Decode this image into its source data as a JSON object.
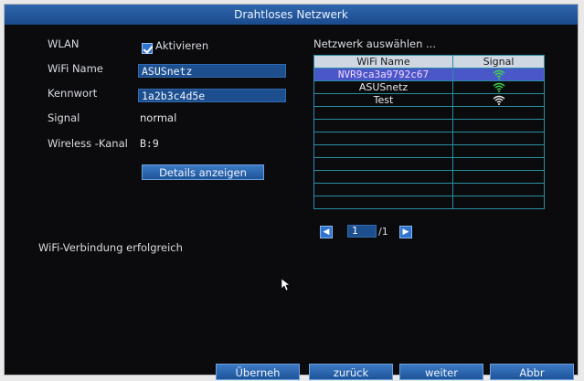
{
  "dialog": {
    "title": "Drahtloses Netzwerk"
  },
  "form": {
    "wlan_label": "WLAN",
    "wlan_checkbox_label": "Aktivieren",
    "wlan_checked": true,
    "wifi_name_label": "WiFi Name",
    "wifi_name_value": "ASUSnetz",
    "password_label": "Kennwort",
    "password_value": "1a2b3c4d5e",
    "signal_label": "Signal",
    "signal_value": "normal",
    "channel_label": "Wireless -Kanal",
    "channel_value": "B:9",
    "details_button": "Details anzeigen"
  },
  "network_list": {
    "heading": "Netzwerk auswählen ...",
    "columns": [
      "WiFi Name",
      "Signal"
    ],
    "rows": [
      {
        "name": "NVR9ca3a9792c67",
        "signal_icon": "wifi-icon",
        "signal_color": "#3fd24a",
        "selected": true
      },
      {
        "name": "ASUSnetz",
        "signal_icon": "wifi-icon",
        "signal_color": "#3fd24a",
        "selected": false
      },
      {
        "name": "Test",
        "signal_icon": "wifi-icon",
        "signal_color": "#e8e8e8",
        "selected": false
      }
    ],
    "empty_rows": 8
  },
  "pager": {
    "current": "1",
    "total_label": "/1",
    "prev_icon": "chevron-left-icon",
    "next_icon": "chevron-right-icon"
  },
  "status": {
    "message": "WiFi-Verbindung erfolgreich"
  },
  "footer": {
    "apply": "Überneh",
    "back": "zurück",
    "next": "weiter",
    "cancel": "Abbr"
  },
  "colors": {
    "title_bar": "#1f5296",
    "panel_bg": "#0b0b0d",
    "field_bg": "#1d4f8f",
    "selected_row": "#4a57c9",
    "table_border": "#2a8ea3"
  }
}
